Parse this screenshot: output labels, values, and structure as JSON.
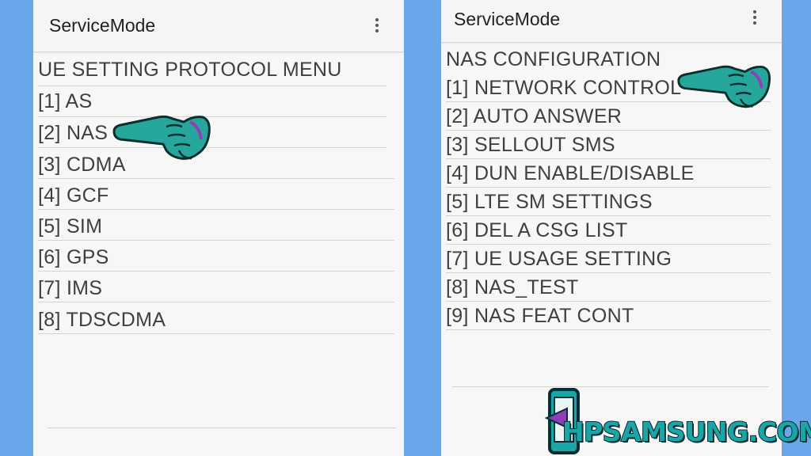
{
  "left_screen": {
    "app_title": "ServiceMode",
    "menu_icon": "more-vert-icon",
    "lines": [
      "UE SETTING PROTOCOL MENU",
      "[1] AS",
      "[2] NAS",
      "[3] CDMA",
      "[4] GCF",
      "[5] SIM",
      "[6] GPS",
      "[7] IMS",
      "[8] TDSCDMA"
    ],
    "pointer_icon": "pointing-hand-icon"
  },
  "right_screen": {
    "app_title": "ServiceMode",
    "menu_icon": "more-vert-icon",
    "lines": [
      "NAS CONFIGURATION",
      "[1] NETWORK CONTROL",
      "[2] AUTO ANSWER",
      "[3] SELLOUT SMS",
      "[4] DUN ENABLE/DISABLE",
      "[5] LTE SM SETTINGS",
      "[6] DEL A CSG LIST",
      "[7] UE USAGE SETTING",
      "[8] NAS_TEST",
      "[9] NAS FEAT CONT"
    ],
    "pointer_icon": "pointing-hand-icon"
  },
  "watermark": {
    "text": "HPSAMSUNG.COM",
    "icon": "phone-logo-icon"
  },
  "colors": {
    "background": "#6aa6ea",
    "screen": "#f7f7f7",
    "hand_fill": "#27a79c",
    "hand_outline": "#0b2f2d",
    "hand_accent": "#8e3fb8",
    "brand_teal": "#1aa6a6"
  }
}
